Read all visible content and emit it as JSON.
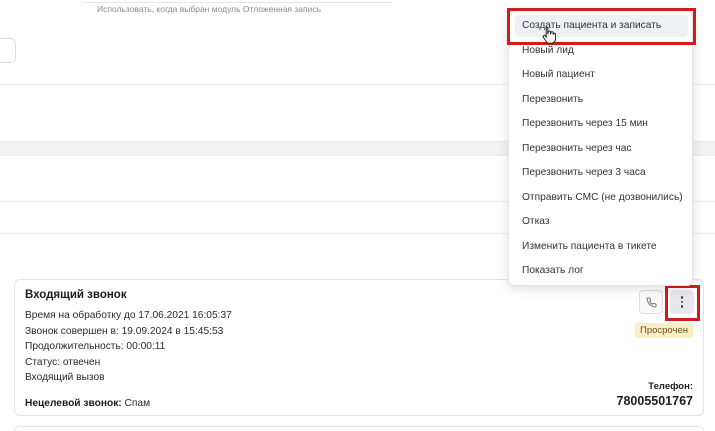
{
  "background": {
    "hint_text": "Использовать, когда выбран модуль Отложенная запись"
  },
  "card": {
    "title": "Входящий звонок",
    "lines": [
      "Время на обработку до 17.06.2021 16:05:37",
      "Звонок совершен в: 19.09.2024 в 15:45:53",
      "Продолжительность: 00:00:11",
      "Статус: отвечен",
      "Входящий вызов"
    ],
    "target_label": "Нецелевой звонок:",
    "target_value": "Спам",
    "status_badge": "Просрочен",
    "phone_label": "Телефон:",
    "phone_value": "78005501767",
    "call_icon": "phone-icon",
    "more_icon": "more-vertical-icon"
  },
  "menu": {
    "items": [
      {
        "label": "Создать пациента и записать",
        "active": true
      },
      {
        "label": "Новый лид"
      },
      {
        "label": "Новый пациент"
      },
      {
        "label": "Перезвонить"
      },
      {
        "label": "Перезвонить через 15 мин"
      },
      {
        "label": "Перезвонить через час"
      },
      {
        "label": "Перезвонить через 3 часа"
      },
      {
        "label": "Отправить СМС (не дозвонились)"
      },
      {
        "label": "Отказ"
      },
      {
        "label": "Изменить пациента в тикете"
      },
      {
        "label": "Показать лог"
      }
    ]
  },
  "colors": {
    "highlight": "#d21b1b",
    "badge_bg": "#fbedc4",
    "menu_active_bg": "#eef0f4"
  }
}
